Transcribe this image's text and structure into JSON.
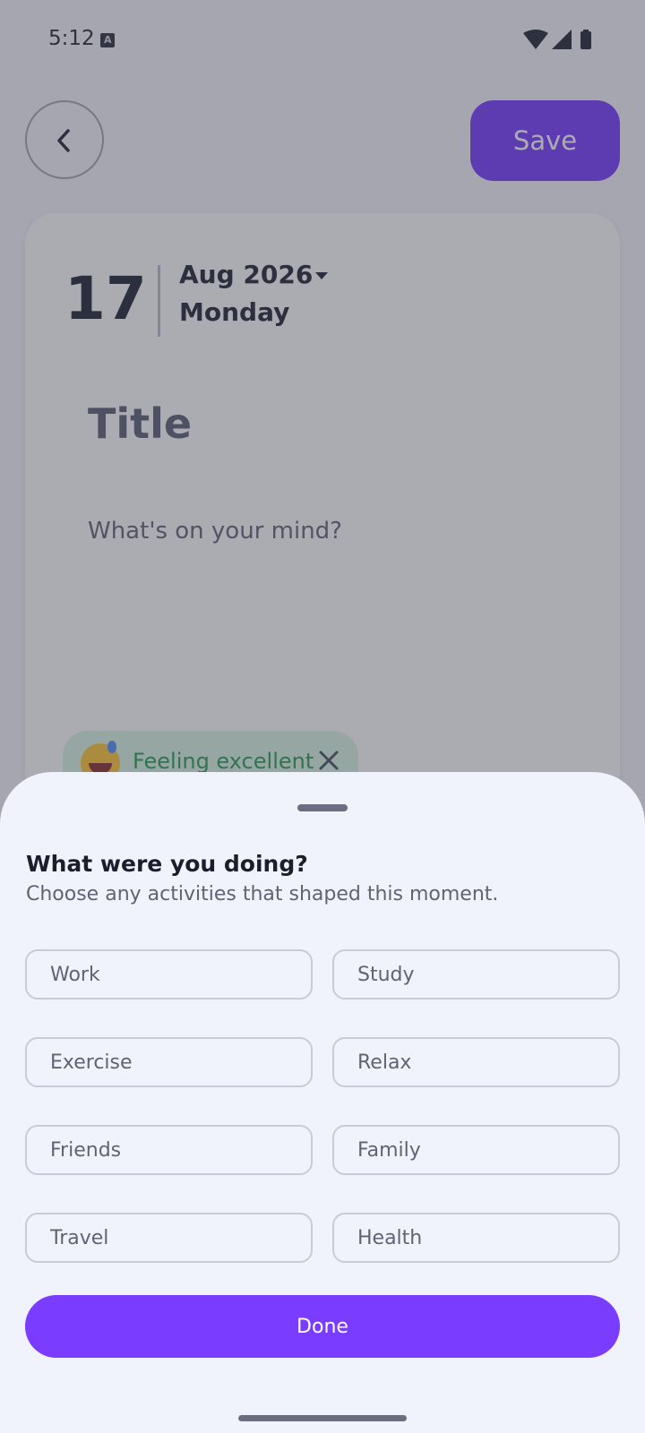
{
  "status_bar": {
    "time": "5:12",
    "notification_icon": "a-keyboard-icon",
    "icons": [
      "wifi-icon",
      "cellular-signal-icon",
      "battery-icon"
    ]
  },
  "header": {
    "back_icon": "chevron-left-icon",
    "save_label": "Save"
  },
  "entry": {
    "day": "17",
    "month_year": "Aug 2026",
    "weekday": "Monday",
    "title_placeholder": "Title",
    "body_placeholder": "What's on your mind?",
    "mood": {
      "label": "Feeling excellent",
      "icon": "grinning-sweat-emoji-icon"
    }
  },
  "sheet": {
    "title": "What were you doing?",
    "subtitle": "Choose any activities that shaped this moment.",
    "activities": [
      "Work",
      "Study",
      "Exercise",
      "Relax",
      "Friends",
      "Family",
      "Travel",
      "Health"
    ],
    "done_label": "Done"
  },
  "colors": {
    "accent": "#7a3cff",
    "sheet_background": "#f0f3fb",
    "mood_chip": "#d9f4e3",
    "mood_text": "#2c9a55"
  }
}
